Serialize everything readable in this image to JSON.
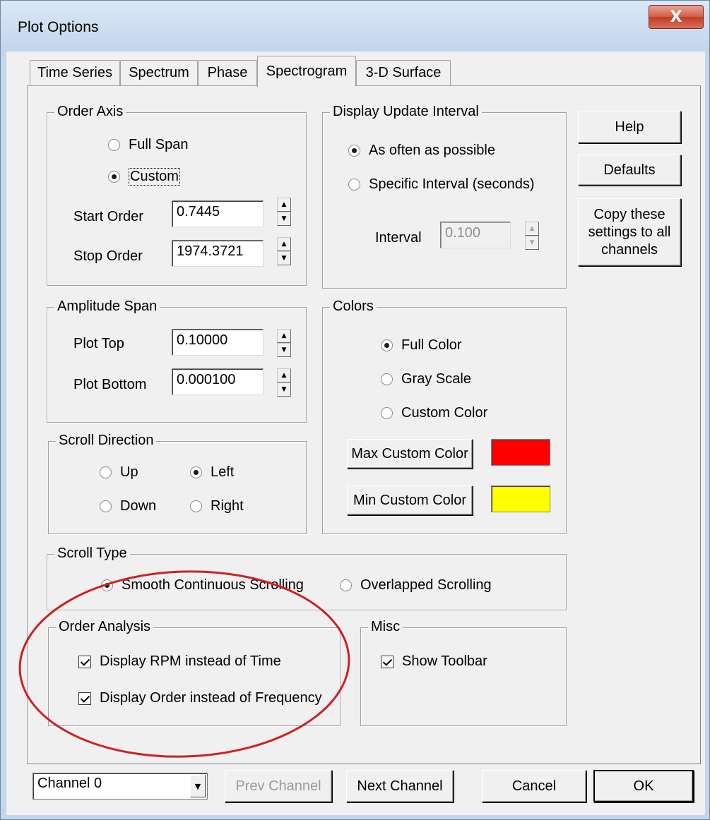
{
  "window": {
    "title": "Plot Options",
    "close_glyph": "X"
  },
  "tabs": [
    {
      "label": "Time Series",
      "active": false
    },
    {
      "label": "Spectrum",
      "active": false
    },
    {
      "label": "Phase",
      "active": false
    },
    {
      "label": "Spectrogram",
      "active": true
    },
    {
      "label": "3-D Surface",
      "active": false
    }
  ],
  "order_axis": {
    "legend": "Order Axis",
    "full_span_label": "Full Span",
    "custom_label": "Custom",
    "selected": "Custom",
    "start_order_label": "Start Order",
    "start_order_value": "0.7445",
    "stop_order_label": "Stop Order",
    "stop_order_value": "1974.3721"
  },
  "display_update": {
    "legend": "Display Update Interval",
    "as_often_label": "As often as possible",
    "specific_label": "Specific Interval (seconds)",
    "selected": "As often as possible",
    "interval_label": "Interval",
    "interval_value": "0.100"
  },
  "side_buttons": {
    "help": "Help",
    "defaults": "Defaults",
    "copy_line1": "Copy these",
    "copy_line2": "settings to all",
    "copy_line3": "channels"
  },
  "amplitude_span": {
    "legend": "Amplitude Span",
    "plot_top_label": "Plot Top",
    "plot_top_value": "0.10000",
    "plot_bottom_label": "Plot Bottom",
    "plot_bottom_value": "0.000100"
  },
  "colors": {
    "legend": "Colors",
    "full_color_label": "Full Color",
    "gray_scale_label": "Gray Scale",
    "custom_color_label": "Custom Color",
    "selected": "Full Color",
    "max_custom_button": "Max Custom Color",
    "min_custom_button": "Min Custom Color",
    "max_color": "#ff0000",
    "min_color": "#ffff00"
  },
  "scroll_direction": {
    "legend": "Scroll Direction",
    "up_label": "Up",
    "down_label": "Down",
    "left_label": "Left",
    "right_label": "Right",
    "selected": "Left"
  },
  "scroll_type": {
    "legend": "Scroll Type",
    "smooth_label": "Smooth Continuous Scrolling",
    "overlapped_label": "Overlapped Scrolling",
    "selected": "Smooth Continuous Scrolling"
  },
  "order_analysis": {
    "legend": "Order Analysis",
    "rpm_label": "Display RPM instead of Time",
    "rpm_checked": true,
    "order_label": "Display Order instead of Frequency",
    "order_checked": true
  },
  "misc": {
    "legend": "Misc",
    "toolbar_label": "Show Toolbar",
    "toolbar_checked": true
  },
  "footer": {
    "channel_value": "Channel 0",
    "prev_channel": "Prev Channel",
    "next_channel": "Next Channel",
    "cancel": "Cancel",
    "ok": "OK"
  },
  "annotation": {
    "color": "#cc2222"
  }
}
